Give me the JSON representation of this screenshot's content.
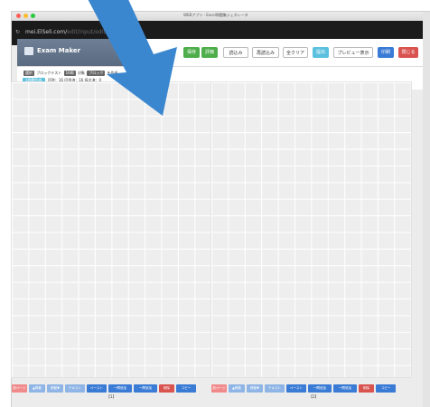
{
  "window": {
    "title": "WEBアプリ - Excel問題集ジェネレータ"
  },
  "browser": {
    "url_visible": "mei.ElSeli.com/",
    "url_faded": "edit/input/edit/index"
  },
  "app": {
    "logo_text": "Exam Maker",
    "buttons": {
      "save": "保存",
      "grade": "評価",
      "load": "読込み",
      "reload": "再読込み",
      "clear_all": "全クリア",
      "submit": "提出",
      "preview": "プレビュー表示",
      "print": "印刷",
      "close": "閉じる"
    }
  },
  "info": {
    "line1_prefix": "選択",
    "line1_text": "ブロックテスト",
    "line1_tag1": "16問",
    "line1_mid": "対象",
    "line1_tag2": "ブロック",
    "line1_end": "を作成",
    "line2_badge": "1問題作成",
    "line2_text": "回答：16 回答済：16 採点済：0"
  },
  "pages": [
    {
      "label": "【1】",
      "toolbar": [
        "前ページ",
        "▲移動",
        "移動▼",
        "テキスト",
        "コピー",
        "ペースト",
        "一問追加",
        "一問追加",
        "削除",
        "コピー"
      ]
    },
    {
      "label": "【2】",
      "toolbar": [
        "前ページ",
        "▲移動",
        "移動▼",
        "テキスト",
        "コピー",
        "ペースト",
        "一問追加",
        "一問追加",
        "削除",
        "コピー"
      ]
    }
  ],
  "colors": {
    "arrow": "#3a87cf",
    "header_logo_bg": "#5f6f85"
  }
}
